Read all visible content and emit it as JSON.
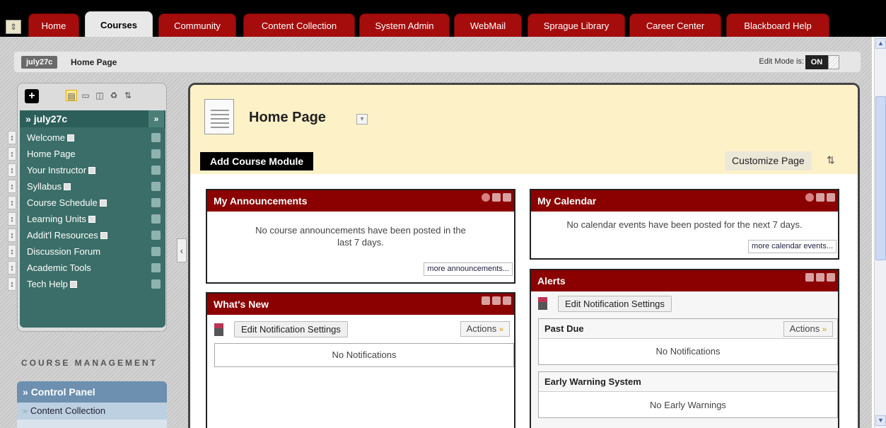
{
  "tabs": [
    {
      "label": "Home",
      "active": false
    },
    {
      "label": "Courses",
      "active": true
    },
    {
      "label": "Community",
      "active": false
    },
    {
      "label": "Content Collection",
      "active": false
    },
    {
      "label": "System Admin",
      "active": false
    },
    {
      "label": "WebMail",
      "active": false
    },
    {
      "label": "Sprague Library",
      "active": false
    },
    {
      "label": "Career Center",
      "active": false
    },
    {
      "label": "Blackboard Help",
      "active": false
    }
  ],
  "breadcrumb": {
    "course": "july27c",
    "page": "Home Page"
  },
  "edit_mode": {
    "label": "Edit Mode is:",
    "value": "ON"
  },
  "sidebar": {
    "course_title": "july27c",
    "items": [
      {
        "label": "Welcome",
        "tile": true
      },
      {
        "label": "Home Page",
        "tile": false
      },
      {
        "label": "Your Instructor",
        "tile": true
      },
      {
        "label": "Syllabus",
        "tile": true
      },
      {
        "label": "Course Schedule",
        "tile": true
      },
      {
        "label": "Learning Units",
        "tile": true
      },
      {
        "label": "Addit'l Resources",
        "tile": true
      },
      {
        "label": "Discussion Forum",
        "tile": false
      },
      {
        "label": "Academic Tools",
        "tile": false
      },
      {
        "label": "Tech Help",
        "tile": true
      }
    ]
  },
  "course_management": {
    "title": "COURSE MANAGEMENT",
    "control_panel": "Control Panel",
    "first_item": "Content Collection"
  },
  "page": {
    "title": "Home Page",
    "add_module": "Add Course Module",
    "customize": "Customize Page"
  },
  "modules": {
    "announcements": {
      "title": "My Announcements",
      "text": "No course announcements have been posted in the last 7 days.",
      "more": "more announcements..."
    },
    "whats_new": {
      "title": "What's New",
      "edit_btn": "Edit Notification Settings",
      "actions": "Actions",
      "empty": "No Notifications"
    },
    "calendar": {
      "title": "My Calendar",
      "text": "No calendar events have been posted for the next 7 days.",
      "more": "more calendar events..."
    },
    "alerts": {
      "title": "Alerts",
      "edit_btn": "Edit Notification Settings",
      "past_due": "Past Due",
      "actions": "Actions",
      "past_due_empty": "No Notifications",
      "early_warning": "Early Warning System",
      "early_warning_empty": "No Early Warnings"
    }
  },
  "colors": {
    "tab_red": "#a50d0d",
    "module_header": "#8b0000",
    "menu_teal": "#3b6e68",
    "content_header": "#fdf1c8"
  }
}
